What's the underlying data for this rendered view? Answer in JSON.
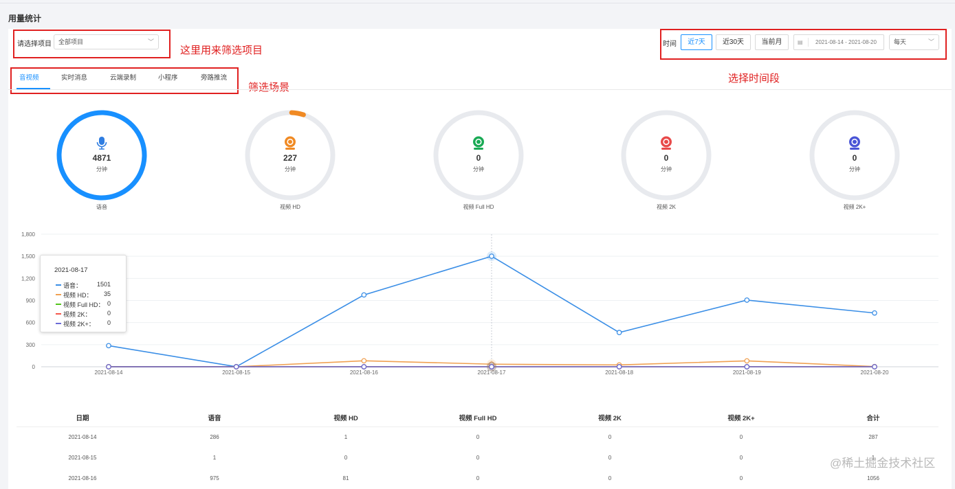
{
  "page": {
    "title": "用量统计"
  },
  "filters": {
    "project_label": "请选择项目",
    "project_value": "全部项目",
    "time_label": "时间",
    "quick_ranges": [
      "近7天",
      "近30天",
      "当前月"
    ],
    "active_range": "近7天",
    "date_range": "2021-08-14 - 2021-08-20",
    "granularity": "每天"
  },
  "annotations": {
    "project": "这里用来筛选项目",
    "scene": "筛选场景",
    "time": "选择时间段"
  },
  "tabs": [
    {
      "label": "音视频",
      "active": true
    },
    {
      "label": "实时消息",
      "active": false
    },
    {
      "label": "云端录制",
      "active": false
    },
    {
      "label": "小程序",
      "active": false
    },
    {
      "label": "旁路推流",
      "active": false
    }
  ],
  "summary": [
    {
      "label": "语音",
      "value": "4871",
      "unit": "分钟",
      "color": "#1890ff",
      "progress": 1.0,
      "icon": "microphone-icon"
    },
    {
      "label": "视频 HD",
      "value": "227",
      "unit": "分钟",
      "color": "#f08a24",
      "progress": 0.045,
      "icon": "webcam-icon"
    },
    {
      "label": "视频 Full HD",
      "value": "0",
      "unit": "分钟",
      "color": "#1aaa55",
      "progress": 0,
      "icon": "webcam-icon"
    },
    {
      "label": "视频 2K",
      "value": "0",
      "unit": "分钟",
      "color": "#e84a4a",
      "progress": 0,
      "icon": "webcam-icon"
    },
    {
      "label": "视频 2K+",
      "value": "0",
      "unit": "分钟",
      "color": "#4a55d6",
      "progress": 0,
      "icon": "webcam-icon"
    }
  ],
  "chart_data": {
    "type": "line",
    "x": [
      "2021-08-14",
      "2021-08-15",
      "2021-08-16",
      "2021-08-17",
      "2021-08-18",
      "2021-08-19",
      "2021-08-20"
    ],
    "ylim": [
      0,
      1800
    ],
    "yticks": [
      "0",
      "300",
      "600",
      "900",
      "1,200",
      "1,500",
      "1,800"
    ],
    "grid": true,
    "series": [
      {
        "name": "语音",
        "color": "#3a8ee6",
        "values": [
          286,
          1,
          975,
          1501,
          465,
          905,
          730
        ]
      },
      {
        "name": "视频 HD",
        "color": "#f0a050",
        "values": [
          1,
          0,
          81,
          35,
          25,
          80,
          3
        ]
      },
      {
        "name": "视频 Full HD",
        "color": "#52c41a",
        "values": [
          0,
          0,
          0,
          0,
          0,
          0,
          0
        ]
      },
      {
        "name": "视频 2K",
        "color": "#f5564a",
        "values": [
          0,
          0,
          0,
          0,
          0,
          0,
          0
        ]
      },
      {
        "name": "视频 2K+",
        "color": "#6b6bd6",
        "values": [
          0,
          0,
          0,
          0,
          0,
          0,
          0
        ]
      }
    ]
  },
  "tooltip": {
    "date": "2021-08-17",
    "rows": [
      {
        "name": "语音：",
        "value": "1501",
        "color": "#3a8ee6"
      },
      {
        "name": "视频 HD：",
        "value": "35",
        "color": "#f0a050"
      },
      {
        "name": "视频 Full HD：",
        "value": "0",
        "color": "#52c41a"
      },
      {
        "name": "视频 2K：",
        "value": "0",
        "color": "#f5564a"
      },
      {
        "name": "视频 2K+：",
        "value": "0",
        "color": "#6b6bd6"
      }
    ]
  },
  "table": {
    "columns": [
      "日期",
      "语音",
      "视频 HD",
      "视频 Full HD",
      "视频 2K",
      "视频 2K+",
      "合计"
    ],
    "rows": [
      [
        "2021-08-14",
        "286",
        "1",
        "0",
        "0",
        "0",
        "287"
      ],
      [
        "2021-08-15",
        "1",
        "0",
        "0",
        "0",
        "0",
        "1"
      ],
      [
        "2021-08-16",
        "975",
        "81",
        "0",
        "0",
        "0",
        "1056"
      ]
    ]
  },
  "watermark": "@稀土掘金技术社区"
}
